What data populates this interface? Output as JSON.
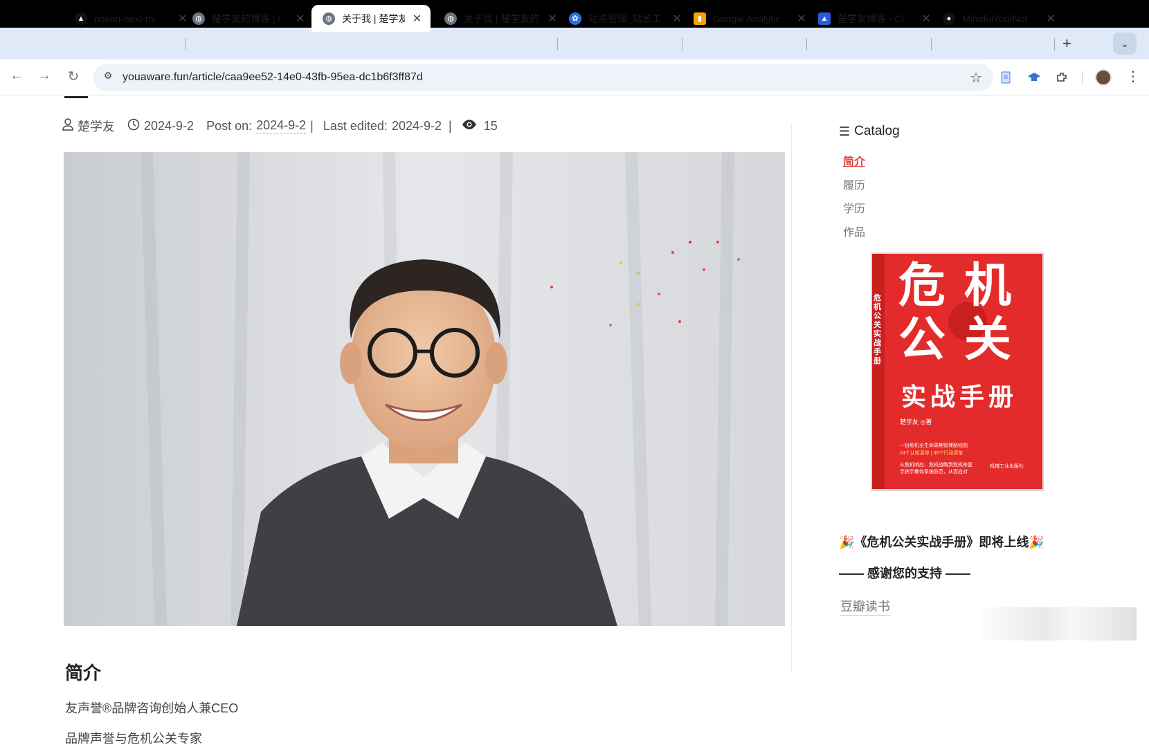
{
  "browser": {
    "tabs": [
      {
        "title": "notion-next-mi",
        "favicon": "notion-icon",
        "fav_color": "#111111",
        "active": false
      },
      {
        "title": "楚学友的博客 | /",
        "favicon": "globe-icon",
        "fav_color": "#6b7280",
        "active": false
      },
      {
        "title": "关于我 | 楚学友的",
        "favicon": "globe-icon",
        "fav_color": "#6b7280",
        "active": true
      },
      {
        "title": "关于我 | 楚学友的",
        "favicon": "globe-icon",
        "fav_color": "#6b7280",
        "active": false
      },
      {
        "title": "站点管理_站长工",
        "favicon": "baidu-icon",
        "fav_color": "#2f6fe4",
        "active": false
      },
      {
        "title": "Google Analytic",
        "favicon": "analytics-icon",
        "fav_color": "#f4a300",
        "active": false
      },
      {
        "title": "楚学友博客 - Cl",
        "favicon": "cloud-icon",
        "fav_color": "#2a5bd7",
        "active": false
      },
      {
        "title": "MindfulYou/Not",
        "favicon": "github-icon",
        "fav_color": "#111111",
        "active": false
      }
    ],
    "url": "youaware.fun/article/caa9ee52-14e0-43fb-95ea-dc1b6f3ff87d"
  },
  "article": {
    "author": "楚学友",
    "date": "2024-9-2",
    "post_on_label": "Post on:",
    "post_on": "2024-9-2",
    "last_edited_label": "Last edited:",
    "last_edited": "2024-9-2",
    "views": "15",
    "section_title": "简介",
    "paragraphs": [
      "友声誉®品牌咨询创始人兼CEO",
      "品牌声誉与危机公关专家"
    ]
  },
  "sidebar": {
    "catalog_label": "Catalog",
    "items": [
      {
        "label": "简介",
        "active": true
      },
      {
        "label": "履历",
        "active": false
      },
      {
        "label": "学历",
        "active": false
      },
      {
        "label": "作品",
        "active": false
      }
    ],
    "book": {
      "title_line1": "危 机",
      "title_line2": "公 关",
      "title_line3": "实战手册",
      "spine": "危机公关实战手册",
      "author": "楚学友 ◎著",
      "blurb1": "一份危机全生命周期管理路线图",
      "blurb2": "24个认知清单 | 38个行动清单",
      "blurb3": "从危机响应、危机战略到危机修复",
      "blurb4": "手把手教你系统防范，从容应对",
      "publisher": "机械工业出版社",
      "color": "#e32b2b"
    },
    "promo": "🎉《危机公关实战手册》即将上线🎉",
    "thanks": "—— 感谢您的支持 ——",
    "douban": "豆瓣读书"
  }
}
